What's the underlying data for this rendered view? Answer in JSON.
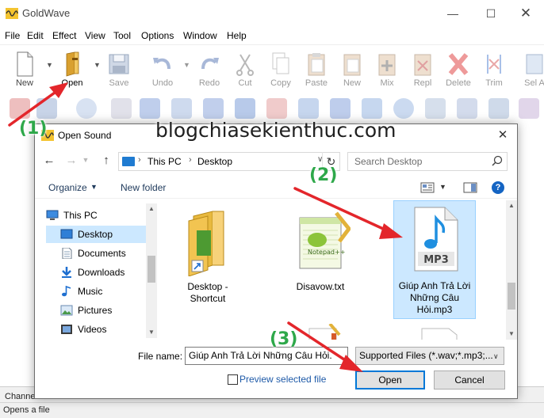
{
  "app": {
    "title": "GoldWave",
    "window_controls": {
      "minimize": "—",
      "maximize": "☐",
      "close": "✕"
    },
    "menu": [
      "File",
      "Edit",
      "Effect",
      "View",
      "Tool",
      "Options",
      "Window",
      "Help"
    ],
    "toolbar": [
      {
        "label": "New",
        "icon": "new-file-icon",
        "enabled": true
      },
      {
        "label": "Open",
        "icon": "open-folder-icon",
        "enabled": true
      },
      {
        "label": "Save",
        "icon": "save-icon",
        "enabled": false
      },
      {
        "label": "Undo",
        "icon": "undo-icon",
        "enabled": false
      },
      {
        "label": "Redo",
        "icon": "redo-icon",
        "enabled": false
      },
      {
        "label": "Cut",
        "icon": "cut-icon",
        "enabled": false
      },
      {
        "label": "Copy",
        "icon": "copy-icon",
        "enabled": false
      },
      {
        "label": "Paste",
        "icon": "paste-icon",
        "enabled": false
      },
      {
        "label": "New",
        "icon": "paste-new-icon",
        "enabled": false
      },
      {
        "label": "Mix",
        "icon": "mix-icon",
        "enabled": false
      },
      {
        "label": "Repl",
        "icon": "replace-icon",
        "enabled": false
      },
      {
        "label": "Delete",
        "icon": "delete-icon",
        "enabled": false
      },
      {
        "label": "Trim",
        "icon": "trim-icon",
        "enabled": false
      },
      {
        "label": "Sel A",
        "icon": "select-all-icon",
        "enabled": false
      }
    ],
    "bottom_label": "Channe",
    "status_text": "Opens a file"
  },
  "dialog": {
    "title": "Open Sound",
    "close": "✕",
    "nav": {
      "back": "←",
      "forward": "→",
      "up": "↑",
      "refresh": "↻"
    },
    "breadcrumb": [
      "This PC",
      "Desktop"
    ],
    "search_placeholder": "Search Desktop",
    "organize": "Organize",
    "new_folder": "New folder",
    "help": "?",
    "sidebar": [
      {
        "label": "This PC",
        "icon": "computer-icon",
        "selected": false
      },
      {
        "label": "Desktop",
        "icon": "desktop-icon",
        "selected": true
      },
      {
        "label": "Documents",
        "icon": "documents-icon",
        "selected": false
      },
      {
        "label": "Downloads",
        "icon": "downloads-icon",
        "selected": false
      },
      {
        "label": "Music",
        "icon": "music-icon",
        "selected": false
      },
      {
        "label": "Pictures",
        "icon": "pictures-icon",
        "selected": false
      },
      {
        "label": "Videos",
        "icon": "videos-icon",
        "selected": false
      }
    ],
    "files": [
      {
        "name_line1": "Desktop -",
        "name_line2": "Shortcut",
        "name_line3": "",
        "icon": "shortcut-folder-icon",
        "selected": false
      },
      {
        "name_line1": "Disavow.txt",
        "name_line2": "",
        "name_line3": "",
        "icon": "notepad-file-icon",
        "selected": false
      },
      {
        "name_line1": "Giúp Anh Trả Lời",
        "name_line2": "Những Câu",
        "name_line3": "Hỏi.mp3",
        "icon": "mp3-file-icon",
        "selected": true
      }
    ],
    "mp3_badge": "MP3",
    "file_name_label": "File name:",
    "file_name_value": "Giúp Anh Trả Lời Những Câu Hỏi.",
    "file_type_value": "Supported Files (*.wav;*.mp3;...",
    "preview_label": "Preview selected file",
    "open_button": "Open",
    "cancel_button": "Cancel"
  },
  "annotations": {
    "watermark": "blogchiasekienthuc.com",
    "step1": "(1)",
    "step2": "(2)",
    "step3": "(3)",
    "arrow_color": "#e3262b",
    "step_color": "#2ea84a"
  }
}
